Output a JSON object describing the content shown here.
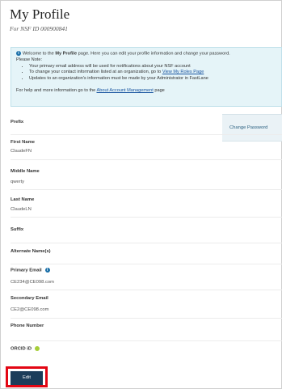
{
  "header": {
    "title": "My Profile",
    "subtitle": "For NSF ID 000900841"
  },
  "info": {
    "intro_prefix": "Welcome to the ",
    "intro_bold": "My Profile",
    "intro_suffix": " page. Here you can edit your profile information and change your password.",
    "note": "Please Note:",
    "bullet1": "Your primary email address will be used for notifications about your NSF account",
    "bullet2_prefix": "To change your contact information listed at an organization, go to ",
    "bullet2_link": "View My Roles Page",
    "bullet3": "Updates to an organization's information must be made by your Administrator in FastLane",
    "help_prefix": "For help and more information go to the ",
    "help_link": "About Account Management",
    "help_suffix": " page"
  },
  "sidebar": {
    "change_password": "Change Password"
  },
  "fields": {
    "prefix": {
      "label": "Prefix",
      "value": ""
    },
    "first_name": {
      "label": "First Name",
      "value": "ClaudeFN"
    },
    "middle_name": {
      "label": "Middle Name",
      "value": "qwerty"
    },
    "last_name": {
      "label": "Last Name",
      "value": "ClaudeLN"
    },
    "suffix": {
      "label": "Suffix",
      "value": ""
    },
    "alternate_name": {
      "label": "Alternate Name(s)",
      "value": ""
    },
    "primary_email": {
      "label": "Primary Email",
      "value": "CE234@CE098.com"
    },
    "secondary_email": {
      "label": "Secondary Email",
      "value": "CE2@CE098.com"
    },
    "phone": {
      "label": "Phone Number",
      "value": ""
    },
    "orcid": {
      "label": "ORCID iD",
      "value": ""
    }
  },
  "actions": {
    "edit_label": "Edit"
  },
  "icons": {
    "info": "info-icon",
    "primary_email": "info-icon",
    "orcid": "orcid-icon"
  },
  "colors": {
    "info_bg": "#e5f4f8",
    "link": "#1a55a0",
    "edit_button": "#1c3d5a",
    "highlight": "#e30613",
    "orcid": "#a6ce39"
  }
}
